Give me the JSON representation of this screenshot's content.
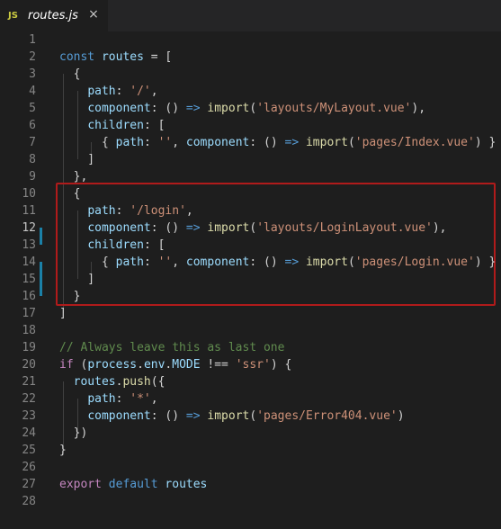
{
  "tab": {
    "lang_badge": "JS",
    "file_name": "routes.js",
    "close_glyph": "×"
  },
  "lines": [
    {
      "n": "1",
      "tokens": []
    },
    {
      "n": "2",
      "tokens": [
        [
          "kw",
          "const "
        ],
        [
          "var",
          "routes"
        ],
        [
          "op",
          " = ["
        ]
      ]
    },
    {
      "n": "3",
      "tokens": [
        [
          "op",
          "  {"
        ]
      ]
    },
    {
      "n": "4",
      "tokens": [
        [
          "op",
          "    "
        ],
        [
          "var",
          "path"
        ],
        [
          "op",
          ": "
        ],
        [
          "str",
          "'/'"
        ],
        [
          "op",
          ","
        ]
      ]
    },
    {
      "n": "5",
      "tokens": [
        [
          "op",
          "    "
        ],
        [
          "var",
          "component"
        ],
        [
          "op",
          ": () "
        ],
        [
          "kw",
          "=>"
        ],
        [
          "op",
          " "
        ],
        [
          "fn",
          "import"
        ],
        [
          "op",
          "("
        ],
        [
          "str",
          "'layouts/MyLayout.vue'"
        ],
        [
          "op",
          "),"
        ]
      ]
    },
    {
      "n": "6",
      "tokens": [
        [
          "op",
          "    "
        ],
        [
          "var",
          "children"
        ],
        [
          "op",
          ": ["
        ]
      ]
    },
    {
      "n": "7",
      "tokens": [
        [
          "op",
          "      { "
        ],
        [
          "var",
          "path"
        ],
        [
          "op",
          ": "
        ],
        [
          "str",
          "''"
        ],
        [
          "op",
          ", "
        ],
        [
          "var",
          "component"
        ],
        [
          "op",
          ": () "
        ],
        [
          "kw",
          "=>"
        ],
        [
          "op",
          " "
        ],
        [
          "fn",
          "import"
        ],
        [
          "op",
          "("
        ],
        [
          "str",
          "'pages/Index.vue'"
        ],
        [
          "op",
          ") }"
        ]
      ]
    },
    {
      "n": "8",
      "tokens": [
        [
          "op",
          "    ]"
        ]
      ]
    },
    {
      "n": "9",
      "tokens": [
        [
          "op",
          "  },"
        ]
      ]
    },
    {
      "n": "10",
      "tokens": [
        [
          "op",
          "  {"
        ]
      ]
    },
    {
      "n": "11",
      "tokens": [
        [
          "op",
          "    "
        ],
        [
          "var",
          "path"
        ],
        [
          "op",
          ": "
        ],
        [
          "str",
          "'/login'"
        ],
        [
          "op",
          ","
        ]
      ]
    },
    {
      "n": "12",
      "tokens": [
        [
          "op",
          "    "
        ],
        [
          "var",
          "component"
        ],
        [
          "op",
          ": () "
        ],
        [
          "kw",
          "=>"
        ],
        [
          "op",
          " "
        ],
        [
          "fn",
          "import"
        ],
        [
          "op",
          "("
        ],
        [
          "str",
          "'layouts/LoginLayout.vue'"
        ],
        [
          "op",
          "),"
        ]
      ],
      "active": true
    },
    {
      "n": "13",
      "tokens": [
        [
          "op",
          "    "
        ],
        [
          "var",
          "children"
        ],
        [
          "op",
          ": ["
        ]
      ]
    },
    {
      "n": "14",
      "tokens": [
        [
          "op",
          "      { "
        ],
        [
          "var",
          "path"
        ],
        [
          "op",
          ": "
        ],
        [
          "str",
          "''"
        ],
        [
          "op",
          ", "
        ],
        [
          "var",
          "component"
        ],
        [
          "op",
          ": () "
        ],
        [
          "kw",
          "=>"
        ],
        [
          "op",
          " "
        ],
        [
          "fn",
          "import"
        ],
        [
          "op",
          "("
        ],
        [
          "str",
          "'pages/Login.vue'"
        ],
        [
          "op",
          ") }"
        ]
      ]
    },
    {
      "n": "15",
      "tokens": [
        [
          "op",
          "    ]"
        ]
      ]
    },
    {
      "n": "16",
      "tokens": [
        [
          "op",
          "  }"
        ]
      ]
    },
    {
      "n": "17",
      "tokens": [
        [
          "op",
          "]"
        ]
      ]
    },
    {
      "n": "18",
      "tokens": []
    },
    {
      "n": "19",
      "tokens": [
        [
          "cmt",
          "// Always leave this as last one"
        ]
      ]
    },
    {
      "n": "20",
      "tokens": [
        [
          "ctl",
          "if"
        ],
        [
          "op",
          " ("
        ],
        [
          "var",
          "process"
        ],
        [
          "op",
          "."
        ],
        [
          "var",
          "env"
        ],
        [
          "op",
          "."
        ],
        [
          "var",
          "MODE"
        ],
        [
          "op",
          " !== "
        ],
        [
          "str",
          "'ssr'"
        ],
        [
          "op",
          ") {"
        ]
      ]
    },
    {
      "n": "21",
      "tokens": [
        [
          "op",
          "  "
        ],
        [
          "var",
          "routes"
        ],
        [
          "op",
          "."
        ],
        [
          "fn",
          "push"
        ],
        [
          "op",
          "({"
        ]
      ]
    },
    {
      "n": "22",
      "tokens": [
        [
          "op",
          "    "
        ],
        [
          "var",
          "path"
        ],
        [
          "op",
          ": "
        ],
        [
          "str",
          "'*'"
        ],
        [
          "op",
          ","
        ]
      ]
    },
    {
      "n": "23",
      "tokens": [
        [
          "op",
          "    "
        ],
        [
          "var",
          "component"
        ],
        [
          "op",
          ": () "
        ],
        [
          "kw",
          "=>"
        ],
        [
          "op",
          " "
        ],
        [
          "fn",
          "import"
        ],
        [
          "op",
          "("
        ],
        [
          "str",
          "'pages/Error404.vue'"
        ],
        [
          "op",
          ")"
        ]
      ]
    },
    {
      "n": "24",
      "tokens": [
        [
          "op",
          "  })"
        ]
      ]
    },
    {
      "n": "25",
      "tokens": [
        [
          "op",
          "}"
        ]
      ]
    },
    {
      "n": "26",
      "tokens": []
    },
    {
      "n": "27",
      "tokens": [
        [
          "ctl",
          "export"
        ],
        [
          "op",
          " "
        ],
        [
          "kw",
          "default"
        ],
        [
          "op",
          " "
        ],
        [
          "var",
          "routes"
        ]
      ]
    },
    {
      "n": "28",
      "tokens": []
    }
  ],
  "colors": {
    "background": "#1e1e1e",
    "keyword": "#569cd6",
    "variable": "#9cdcfe",
    "function": "#dcdcaa",
    "string": "#ce9178",
    "comment": "#608b4e",
    "control": "#c586c0",
    "highlight_border": "#b01b1b",
    "git_modified": "#1b81a8"
  }
}
